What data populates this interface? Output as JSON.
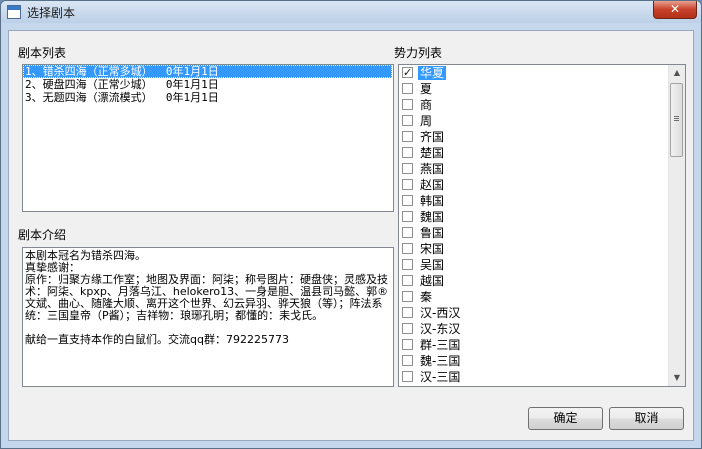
{
  "window": {
    "title": "选择剧本",
    "close_label": "✕"
  },
  "script_list": {
    "label": "剧本列表",
    "items": [
      {
        "label": "1、错杀四海（正常多城）  0年1月1日",
        "selected": true
      },
      {
        "label": "2、硬盘四海（正常少城）  0年1月1日",
        "selected": false
      },
      {
        "label": "3、无题四海（漂流模式）  0年1月1日",
        "selected": false
      }
    ]
  },
  "intro": {
    "label": "剧本介绍",
    "text": "本剧本冠名为错杀四海。\n真挚感谢：\n原作：归聚方缘工作室；地图及界面：阿柒；称号图片：硬盘侠；灵感及技术：阿柒、kpxp、月落乌江、helokero13、一身是胆、温县司马懿、郭®文斌、曲心、随隆大顺、离开这个世界、幻云异羽、骅天狼（等）；阵法系统：三国皇帝（P酱）；吉祥物：琅琊孔明；都懂的：耒戈氏。\n\n献给一直支持本作的白鼠们。交流qq群：792225773"
  },
  "faction_list": {
    "label": "势力列表",
    "items": [
      {
        "label": "华夏",
        "checked": true,
        "selected": true
      },
      {
        "label": "夏",
        "checked": false,
        "selected": false
      },
      {
        "label": "商",
        "checked": false,
        "selected": false
      },
      {
        "label": "周",
        "checked": false,
        "selected": false
      },
      {
        "label": "齐国",
        "checked": false,
        "selected": false
      },
      {
        "label": "楚国",
        "checked": false,
        "selected": false
      },
      {
        "label": "燕国",
        "checked": false,
        "selected": false
      },
      {
        "label": "赵国",
        "checked": false,
        "selected": false
      },
      {
        "label": "韩国",
        "checked": false,
        "selected": false
      },
      {
        "label": "魏国",
        "checked": false,
        "selected": false
      },
      {
        "label": "鲁国",
        "checked": false,
        "selected": false
      },
      {
        "label": "宋国",
        "checked": false,
        "selected": false
      },
      {
        "label": "吴国",
        "checked": false,
        "selected": false
      },
      {
        "label": "越国",
        "checked": false,
        "selected": false
      },
      {
        "label": "秦",
        "checked": false,
        "selected": false
      },
      {
        "label": "汉-西汉",
        "checked": false,
        "selected": false
      },
      {
        "label": "汉-东汉",
        "checked": false,
        "selected": false
      },
      {
        "label": "群-三国",
        "checked": false,
        "selected": false
      },
      {
        "label": "魏-三国",
        "checked": false,
        "selected": false
      },
      {
        "label": "汉-三国",
        "checked": false,
        "selected": false
      }
    ],
    "scrollbar": {
      "up_icon": "arrow-up-icon",
      "down_icon": "arrow-down-icon"
    }
  },
  "buttons": {
    "ok_label": "确定",
    "cancel_label": "取消"
  },
  "colors": {
    "selection": "#3399ff",
    "title_bar": "#c4d7ec",
    "close": "#c8412b"
  }
}
